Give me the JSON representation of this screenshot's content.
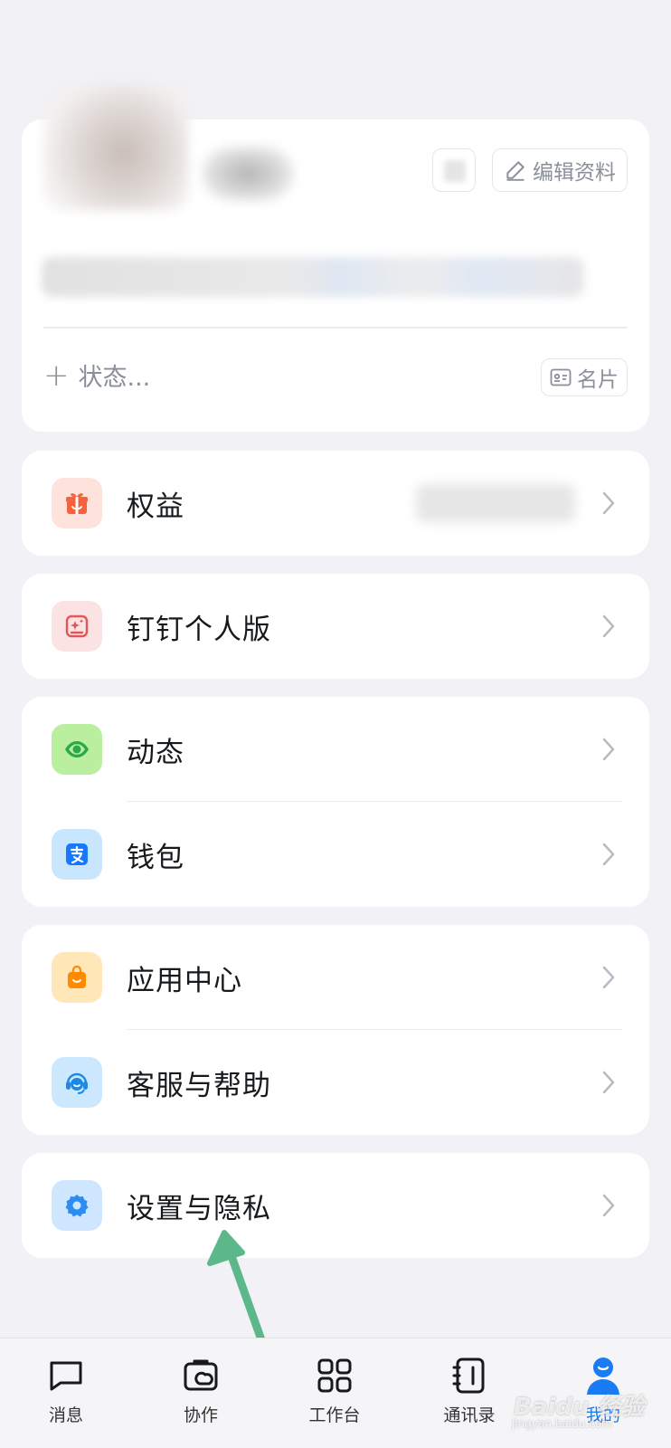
{
  "profile": {
    "edit_label": "编辑资料",
    "status_label": "状态...",
    "card_label": "名片"
  },
  "menu": {
    "benefits": "权益",
    "personal": "钉钉个人版",
    "moments": "动态",
    "wallet": "钱包",
    "app_center": "应用中心",
    "support": "客服与帮助",
    "settings": "设置与隐私"
  },
  "tabs": [
    {
      "label": "消息",
      "icon": "chat-icon"
    },
    {
      "label": "协作",
      "icon": "collab-icon"
    },
    {
      "label": "工作台",
      "icon": "workbench-icon"
    },
    {
      "label": "通讯录",
      "icon": "contacts-icon"
    },
    {
      "label": "我的",
      "icon": "profile-icon",
      "active": true
    }
  ],
  "watermark": {
    "text": "Baidu 经验",
    "sub": "jingyan.baidu.com"
  },
  "colors": {
    "accent": "#1a7cf5",
    "arrow": "#5cb88a",
    "benefits_icon": "#f5623d",
    "personal_icon": "#e0575b",
    "moments_icon": "#2aa84a",
    "wallet_icon": "#1677ff",
    "app_center_icon": "#ff8a00",
    "support_icon": "#1e88e5",
    "settings_icon": "#2d8cf0"
  }
}
